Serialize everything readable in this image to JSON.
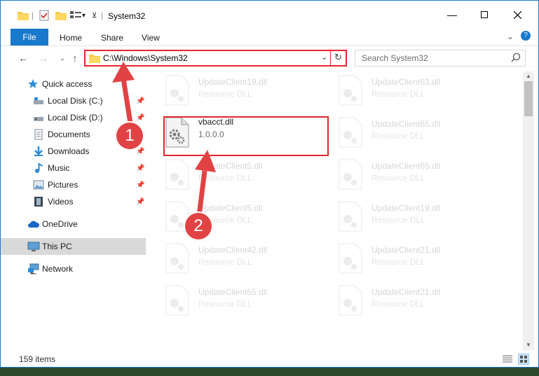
{
  "window": {
    "title": "System32"
  },
  "ribbon": {
    "tabs": [
      "File",
      "Home",
      "Share",
      "View"
    ]
  },
  "address": {
    "path": "C:\\Windows\\System32"
  },
  "search": {
    "placeholder": "Search System32"
  },
  "sidebar": {
    "items": [
      {
        "label": "Quick access",
        "icon": "star-icon",
        "pinned": false
      },
      {
        "label": "Local Disk (C:)",
        "icon": "drive-icon",
        "pinned": true
      },
      {
        "label": "Local Disk (D:)",
        "icon": "drive-icon",
        "pinned": true
      },
      {
        "label": "Documents",
        "icon": "documents-icon",
        "pinned": true
      },
      {
        "label": "Downloads",
        "icon": "download-icon",
        "pinned": true
      },
      {
        "label": "Music",
        "icon": "music-icon",
        "pinned": true
      },
      {
        "label": "Pictures",
        "icon": "pictures-icon",
        "pinned": true
      },
      {
        "label": "Videos",
        "icon": "videos-icon",
        "pinned": true
      },
      {
        "label": "OneDrive",
        "icon": "cloud-icon",
        "pinned": false
      },
      {
        "label": "This PC",
        "icon": "computer-icon",
        "pinned": false,
        "selected": true
      },
      {
        "label": "Network",
        "icon": "network-icon",
        "pinned": false
      }
    ]
  },
  "files": {
    "left": [
      {
        "name": "UpdateClient19.dll",
        "desc": "Resource DLL"
      },
      {
        "name": "vbacct.dll",
        "desc": "1.0.0.0",
        "highlighted": true
      },
      {
        "name": "UpdateClient5.dll",
        "desc": "Resource DLL"
      },
      {
        "name": "UpdateClient5.dll",
        "desc": "Resource DLL"
      },
      {
        "name": "UpdateClient42.dll",
        "desc": "Resource DLL"
      },
      {
        "name": "UpdateClient65.dll",
        "desc": "Resource DLL"
      }
    ],
    "right": [
      {
        "name": "UpdateClient63.dll",
        "desc": "Resource DLL"
      },
      {
        "name": "UpdateClient65.dll",
        "desc": "Resource DLL"
      },
      {
        "name": "UpdateClient65.dll",
        "desc": "Resource DLL"
      },
      {
        "name": "UpdateClient19.dll",
        "desc": "Resource DLL"
      },
      {
        "name": "UpdateClient21.dll",
        "desc": "Resource DLL"
      },
      {
        "name": "UpdateClient21.dll",
        "desc": "Resource DLL"
      }
    ]
  },
  "status": {
    "count": "159 items"
  },
  "annotations": {
    "step1": "1",
    "step2": "2",
    "color": "#e0272d"
  },
  "colors": {
    "accent": "#1979ca",
    "highlight": "#e0272d"
  }
}
